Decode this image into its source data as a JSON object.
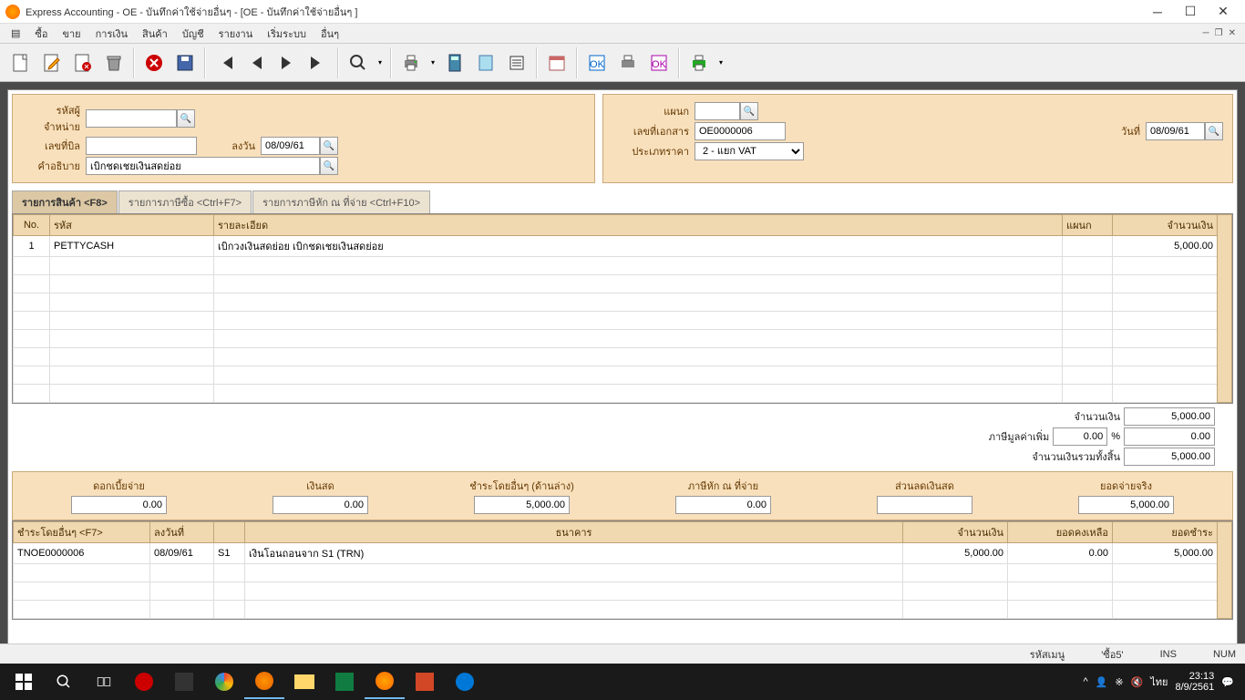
{
  "window": {
    "title": "Express Accounting - OE - บันทึกค่าใช้จ่ายอื่นๆ       - [OE - บันทึกค่าใช้จ่ายอื่นๆ        ]"
  },
  "menu": {
    "items": [
      "ซื้อ",
      "ขาย",
      "การเงิน",
      "สินค้า",
      "บัญชี",
      "รายงาน",
      "เริ่มระบบ",
      "อื่นๆ"
    ]
  },
  "form": {
    "left": {
      "supplier_label": "รหัสผู้จำหน่าย",
      "supplier": "",
      "billno_label": "เลขที่บิล",
      "billno": "",
      "date_label": "ลงวัน",
      "date": "08/09/61",
      "desc_label": "คำอธิบาย",
      "desc": "เบิกชดเชยเงินสดย่อย"
    },
    "right": {
      "dept_label": "แผนก",
      "dept": "",
      "docno_label": "เลขที่เอกสาร",
      "docno": "OE0000006",
      "docdate_label": "วันที่",
      "docdate": "08/09/61",
      "pricetype_label": "ประเภทราคา",
      "pricetype": "2 - แยก VAT"
    }
  },
  "tabs": {
    "items": [
      "รายการสินค้า <F8>",
      "รายการภาษีซื้อ <Ctrl+F7>",
      "รายการภาษีหัก ณ ที่จ่าย <Ctrl+F10>"
    ],
    "active": 0
  },
  "grid": {
    "headers": {
      "no": "No.",
      "code": "รหัส",
      "desc": "รายละเอียด",
      "dept": "แผนก",
      "amount": "จำนวนเงิน"
    },
    "rows": [
      {
        "no": "1",
        "code": "PETTYCASH",
        "desc": "เบิกวงเงินสดย่อย เบิกชดเชยเงินสดย่อย",
        "dept": "",
        "amount": "5,000.00"
      }
    ]
  },
  "totals": {
    "amount_label": "จำนวนเงิน",
    "amount": "5,000.00",
    "vat_label": "ภาษีมูลค่าเพิ่ม",
    "vat_pct": "0.00",
    "pct_sign": "%",
    "vat_amount": "0.00",
    "grand_label": "จำนวนเงินรวมทั้งสิ้น",
    "grand": "5,000.00"
  },
  "payments": {
    "interest": {
      "label": "ดอกเบี้ยจ่าย",
      "value": "0.00"
    },
    "cash": {
      "label": "เงินสด",
      "value": "0.00"
    },
    "other_below": {
      "label": "ชำระโดยอื่นๆ (ด้านล่าง)",
      "value": "5,000.00"
    },
    "wht": {
      "label": "ภาษีหัก ณ ที่จ่าย",
      "value": "0.00"
    },
    "discount": {
      "label": "ส่วนลดเงินสด",
      "value": ""
    },
    "netpay": {
      "label": "ยอดจ่ายจริง",
      "value": "5,000.00"
    }
  },
  "paygrid": {
    "headers": {
      "other": "ชำระโดยอื่นๆ <F7>",
      "date": "ลงวันที่",
      "bank_short": "",
      "bank": "ธนาคาร",
      "amount": "จำนวนเงิน",
      "remain": "ยอดคงเหลือ",
      "pay": "ยอดชำระ"
    },
    "rows": [
      {
        "other": "TNOE0000006",
        "date": "08/09/61",
        "bank_short": "S1",
        "bank": "เงินโอนถอนจาก S1 (TRN)",
        "amount": "5,000.00",
        "remain": "0.00",
        "pay": "5,000.00"
      }
    ]
  },
  "statusbar": {
    "menuid": "รหัสเมนู",
    "menuid_val": "'ซื้อ5'",
    "ins": "INS",
    "num": "NUM"
  },
  "taskbar": {
    "time": "23:13",
    "date": "8/9/2561",
    "lang": "ไทย"
  }
}
